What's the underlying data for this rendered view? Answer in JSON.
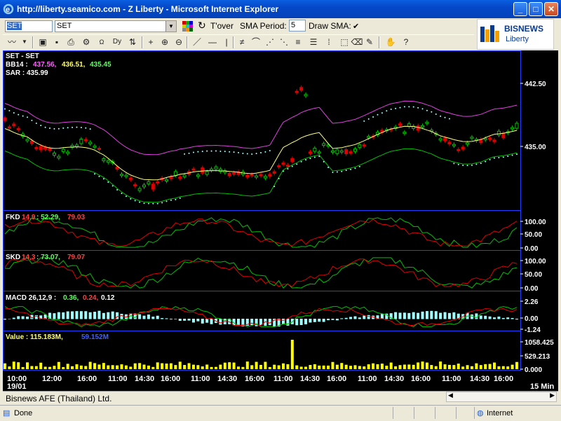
{
  "window": {
    "title": "http://liberty.seamico.com - Z Liberty - Microsoft Internet Explorer",
    "min": "_",
    "max": "□",
    "close": "✕"
  },
  "toolbar": {
    "symbol_box": "SET",
    "symbol_select": "SET",
    "tover": "T'over",
    "sma_period_label": "SMA Period:",
    "sma_period_value": "5",
    "draw_sma_label": "Draw SMA:",
    "draw_sma_checked": "✔"
  },
  "logo": {
    "brand": "BISNEWS",
    "sub": "Liberty"
  },
  "chart": {
    "main_title": "SET - SET",
    "bb_label": "BB14 :",
    "bb_upper": "437.56,",
    "bb_mid": "436.51,",
    "bb_lower": "435.45",
    "sar_label": "SAR : 435.99",
    "fkd_label": "FKD",
    "fkd_params": "14,9",
    "fkd_v1": ": 52.29,",
    "fkd_v2": "79.03",
    "skd_label": "SKD",
    "skd_params": "14,3",
    "skd_v1": ": 73.07,",
    "skd_v2": "79.07",
    "macd_label": "MACD 26,12,9 :",
    "macd_v1": "0.36,",
    "macd_v2": "0.24,",
    "macd_v3": "0.12",
    "value_label": "Value : 115.183M,",
    "value_v2": "59.152M",
    "price_axis": [
      "442.50",
      "435.00"
    ],
    "fkd_axis": [
      "100.00",
      "50.00",
      "0.00"
    ],
    "skd_axis": [
      "100.00",
      "50.00",
      "0.00"
    ],
    "macd_axis": [
      "2.26",
      "0.00",
      "-1.24"
    ],
    "value_axis": [
      "1058.425",
      "529.213",
      "0.000"
    ],
    "time_labels": [
      "10:00",
      "12:00",
      "16:00",
      "11:00",
      "14:30",
      "16:00",
      "11:00",
      "14:30",
      "16:00",
      "11:00",
      "14:30",
      "16:00",
      "11:00",
      "14:30",
      "16:00",
      "11:00",
      "14:30",
      "16:00"
    ],
    "date_label": "19/01",
    "interval": "15 Min"
  },
  "footer": {
    "company": "Bisnews AFE (Thailand) Ltd."
  },
  "ie_status": {
    "done": "Done",
    "zone": "Internet"
  },
  "colors": {
    "up": "#00c000",
    "down": "#e00000",
    "bb": "#e040e0",
    "mid": "#ffff80",
    "sar": "#a0ffff"
  }
}
